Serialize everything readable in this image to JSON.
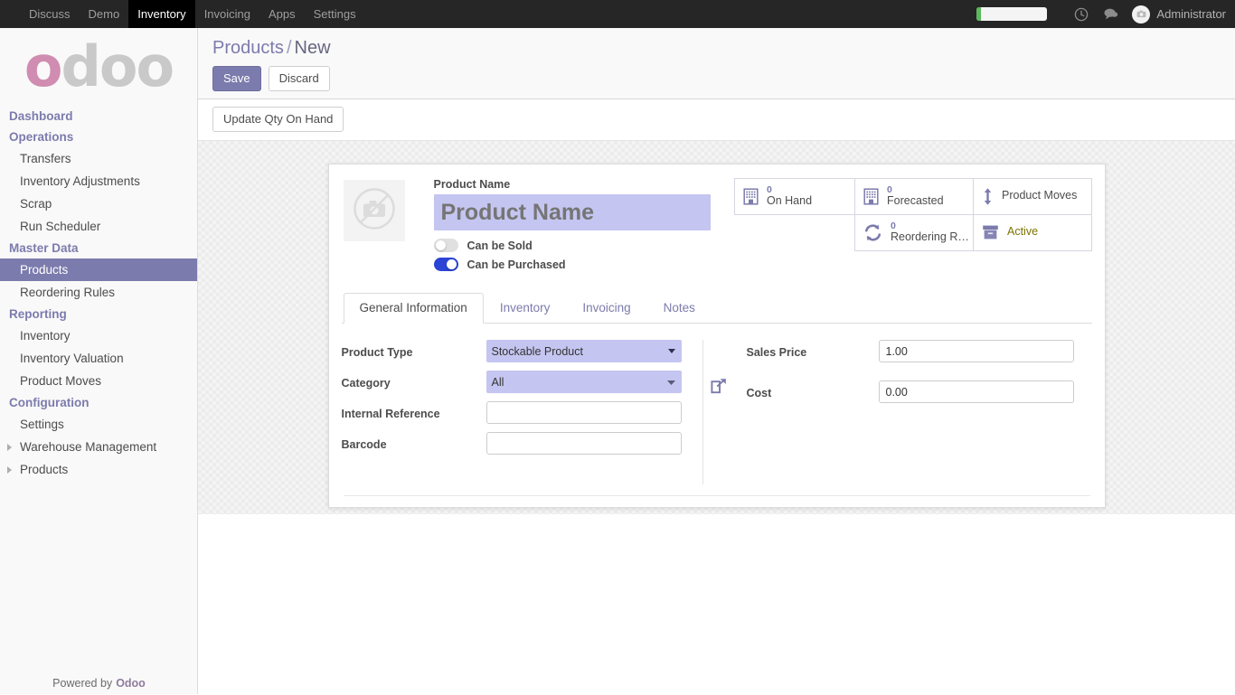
{
  "topbar": {
    "apps": [
      {
        "label": "Discuss",
        "active": false
      },
      {
        "label": "Demo",
        "active": false
      },
      {
        "label": "Inventory",
        "active": true
      },
      {
        "label": "Invoicing",
        "active": false
      },
      {
        "label": "Apps",
        "active": false
      },
      {
        "label": "Settings",
        "active": false
      }
    ],
    "systray": {
      "pill_icon": "progress-pill",
      "clock_icon": "clock-icon",
      "messages_icon": "chat-bubble-icon",
      "avatar_icon": "avatar-camera-icon",
      "user_name": "Administrator"
    }
  },
  "sidebar": {
    "logo_text_first": "o",
    "logo_text_rest": "doo",
    "sections": [
      {
        "label": "Dashboard",
        "type": "section"
      },
      {
        "label": "Operations",
        "type": "section"
      },
      {
        "label": "Transfers",
        "type": "item",
        "active": false,
        "caret": false
      },
      {
        "label": "Inventory Adjustments",
        "type": "item",
        "active": false,
        "caret": false
      },
      {
        "label": "Scrap",
        "type": "item",
        "active": false,
        "caret": false
      },
      {
        "label": "Run Scheduler",
        "type": "item",
        "active": false,
        "caret": false
      },
      {
        "label": "Master Data",
        "type": "section"
      },
      {
        "label": "Products",
        "type": "item",
        "active": true,
        "caret": false
      },
      {
        "label": "Reordering Rules",
        "type": "item",
        "active": false,
        "caret": false
      },
      {
        "label": "Reporting",
        "type": "section"
      },
      {
        "label": "Inventory",
        "type": "item",
        "active": false,
        "caret": false
      },
      {
        "label": "Inventory Valuation",
        "type": "item",
        "active": false,
        "caret": false
      },
      {
        "label": "Product Moves",
        "type": "item",
        "active": false,
        "caret": false
      },
      {
        "label": "Configuration",
        "type": "section"
      },
      {
        "label": "Settings",
        "type": "item",
        "active": false,
        "caret": false
      },
      {
        "label": "Warehouse Management",
        "type": "item",
        "active": false,
        "caret": true
      },
      {
        "label": "Products",
        "type": "item",
        "active": false,
        "caret": true
      }
    ],
    "footer_text": "Powered by",
    "footer_brand": "Odoo"
  },
  "control_panel": {
    "breadcrumb_root": "Products",
    "breadcrumb_sep": "/",
    "breadcrumb_current": "New",
    "save_label": "Save",
    "discard_label": "Discard",
    "stat_action_label": "Update Qty On Hand"
  },
  "form": {
    "image_placeholder_icon": "camera-disabled-icon",
    "product_name_label": "Product Name",
    "product_name_value": "",
    "product_name_placeholder": "Product Name",
    "toggles": [
      {
        "label": "Can be Sold",
        "on": false,
        "name": "can-be-sold-toggle"
      },
      {
        "label": "Can be Purchased",
        "on": true,
        "name": "can-be-purchased-toggle"
      }
    ],
    "stat_buttons": [
      {
        "value": "0",
        "label": "On Hand",
        "icon": "building-icon",
        "style": "value"
      },
      {
        "value": "0",
        "label": "Forecasted",
        "icon": "building-icon",
        "style": "value"
      },
      {
        "value": "",
        "label": "Product Moves",
        "icon": "arrows-vertical-icon",
        "style": "plain"
      },
      {
        "value": "0",
        "label": "Reordering R…",
        "icon": "refresh-cycle-icon",
        "style": "value"
      },
      {
        "value": "",
        "label": "Active",
        "icon": "archive-box-icon",
        "style": "active"
      }
    ],
    "tabs": [
      {
        "label": "General Information",
        "active": true
      },
      {
        "label": "Inventory",
        "active": false
      },
      {
        "label": "Invoicing",
        "active": false
      },
      {
        "label": "Notes",
        "active": false
      }
    ],
    "left_fields": [
      {
        "label": "Product Type",
        "kind": "select",
        "value": "Stockable Product",
        "arrow": "solid"
      },
      {
        "label": "Category",
        "kind": "select",
        "value": "All",
        "arrow": "thin"
      },
      {
        "label": "Internal Reference",
        "kind": "input",
        "value": ""
      },
      {
        "label": "Barcode",
        "kind": "input",
        "value": ""
      }
    ],
    "right_fields": [
      {
        "label": "Sales Price",
        "kind": "input",
        "value": "1.00"
      },
      {
        "label": "Cost",
        "kind": "input",
        "value": "0.00"
      }
    ],
    "external_link_icon": "external-link-icon"
  },
  "colors": {
    "odoo_purple": "#7c7bad",
    "field_fill": "#c5c5f1",
    "toggle_on": "#2b44d6",
    "active_green": "#7c7300",
    "navbar_dark": "#262626",
    "logo_pink": "#d08cb1"
  }
}
